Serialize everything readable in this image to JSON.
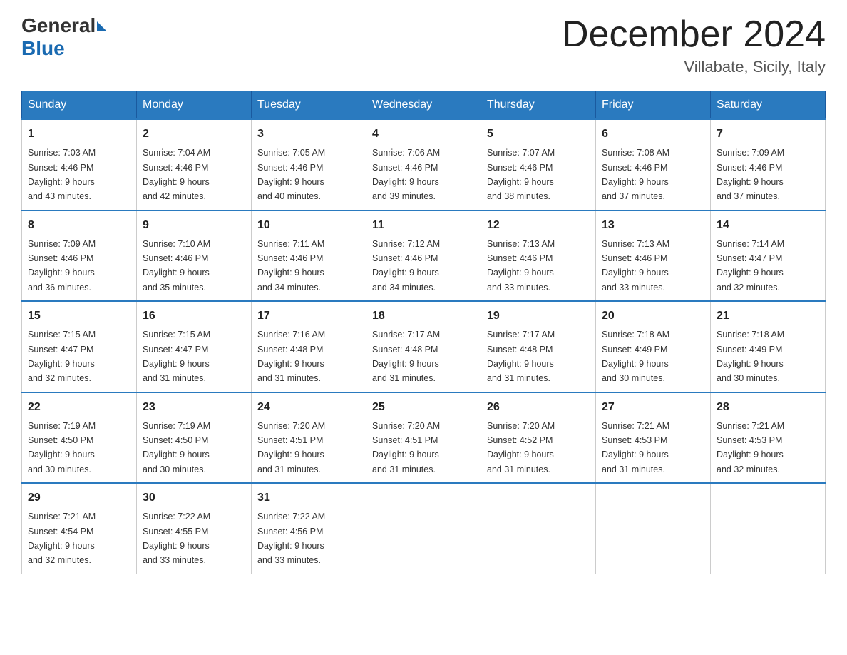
{
  "header": {
    "logo": {
      "general": "General",
      "blue": "Blue"
    },
    "title": "December 2024",
    "location": "Villabate, Sicily, Italy"
  },
  "weekdays": [
    "Sunday",
    "Monday",
    "Tuesday",
    "Wednesday",
    "Thursday",
    "Friday",
    "Saturday"
  ],
  "weeks": [
    [
      {
        "day": "1",
        "sunrise": "7:03 AM",
        "sunset": "4:46 PM",
        "daylight": "9 hours and 43 minutes."
      },
      {
        "day": "2",
        "sunrise": "7:04 AM",
        "sunset": "4:46 PM",
        "daylight": "9 hours and 42 minutes."
      },
      {
        "day": "3",
        "sunrise": "7:05 AM",
        "sunset": "4:46 PM",
        "daylight": "9 hours and 40 minutes."
      },
      {
        "day": "4",
        "sunrise": "7:06 AM",
        "sunset": "4:46 PM",
        "daylight": "9 hours and 39 minutes."
      },
      {
        "day": "5",
        "sunrise": "7:07 AM",
        "sunset": "4:46 PM",
        "daylight": "9 hours and 38 minutes."
      },
      {
        "day": "6",
        "sunrise": "7:08 AM",
        "sunset": "4:46 PM",
        "daylight": "9 hours and 37 minutes."
      },
      {
        "day": "7",
        "sunrise": "7:09 AM",
        "sunset": "4:46 PM",
        "daylight": "9 hours and 37 minutes."
      }
    ],
    [
      {
        "day": "8",
        "sunrise": "7:09 AM",
        "sunset": "4:46 PM",
        "daylight": "9 hours and 36 minutes."
      },
      {
        "day": "9",
        "sunrise": "7:10 AM",
        "sunset": "4:46 PM",
        "daylight": "9 hours and 35 minutes."
      },
      {
        "day": "10",
        "sunrise": "7:11 AM",
        "sunset": "4:46 PM",
        "daylight": "9 hours and 34 minutes."
      },
      {
        "day": "11",
        "sunrise": "7:12 AM",
        "sunset": "4:46 PM",
        "daylight": "9 hours and 34 minutes."
      },
      {
        "day": "12",
        "sunrise": "7:13 AM",
        "sunset": "4:46 PM",
        "daylight": "9 hours and 33 minutes."
      },
      {
        "day": "13",
        "sunrise": "7:13 AM",
        "sunset": "4:46 PM",
        "daylight": "9 hours and 33 minutes."
      },
      {
        "day": "14",
        "sunrise": "7:14 AM",
        "sunset": "4:47 PM",
        "daylight": "9 hours and 32 minutes."
      }
    ],
    [
      {
        "day": "15",
        "sunrise": "7:15 AM",
        "sunset": "4:47 PM",
        "daylight": "9 hours and 32 minutes."
      },
      {
        "day": "16",
        "sunrise": "7:15 AM",
        "sunset": "4:47 PM",
        "daylight": "9 hours and 31 minutes."
      },
      {
        "day": "17",
        "sunrise": "7:16 AM",
        "sunset": "4:48 PM",
        "daylight": "9 hours and 31 minutes."
      },
      {
        "day": "18",
        "sunrise": "7:17 AM",
        "sunset": "4:48 PM",
        "daylight": "9 hours and 31 minutes."
      },
      {
        "day": "19",
        "sunrise": "7:17 AM",
        "sunset": "4:48 PM",
        "daylight": "9 hours and 31 minutes."
      },
      {
        "day": "20",
        "sunrise": "7:18 AM",
        "sunset": "4:49 PM",
        "daylight": "9 hours and 30 minutes."
      },
      {
        "day": "21",
        "sunrise": "7:18 AM",
        "sunset": "4:49 PM",
        "daylight": "9 hours and 30 minutes."
      }
    ],
    [
      {
        "day": "22",
        "sunrise": "7:19 AM",
        "sunset": "4:50 PM",
        "daylight": "9 hours and 30 minutes."
      },
      {
        "day": "23",
        "sunrise": "7:19 AM",
        "sunset": "4:50 PM",
        "daylight": "9 hours and 30 minutes."
      },
      {
        "day": "24",
        "sunrise": "7:20 AM",
        "sunset": "4:51 PM",
        "daylight": "9 hours and 31 minutes."
      },
      {
        "day": "25",
        "sunrise": "7:20 AM",
        "sunset": "4:51 PM",
        "daylight": "9 hours and 31 minutes."
      },
      {
        "day": "26",
        "sunrise": "7:20 AM",
        "sunset": "4:52 PM",
        "daylight": "9 hours and 31 minutes."
      },
      {
        "day": "27",
        "sunrise": "7:21 AM",
        "sunset": "4:53 PM",
        "daylight": "9 hours and 31 minutes."
      },
      {
        "day": "28",
        "sunrise": "7:21 AM",
        "sunset": "4:53 PM",
        "daylight": "9 hours and 32 minutes."
      }
    ],
    [
      {
        "day": "29",
        "sunrise": "7:21 AM",
        "sunset": "4:54 PM",
        "daylight": "9 hours and 32 minutes."
      },
      {
        "day": "30",
        "sunrise": "7:22 AM",
        "sunset": "4:55 PM",
        "daylight": "9 hours and 33 minutes."
      },
      {
        "day": "31",
        "sunrise": "7:22 AM",
        "sunset": "4:56 PM",
        "daylight": "9 hours and 33 minutes."
      },
      null,
      null,
      null,
      null
    ]
  ],
  "labels": {
    "sunrise": "Sunrise:",
    "sunset": "Sunset:",
    "daylight": "Daylight:"
  }
}
